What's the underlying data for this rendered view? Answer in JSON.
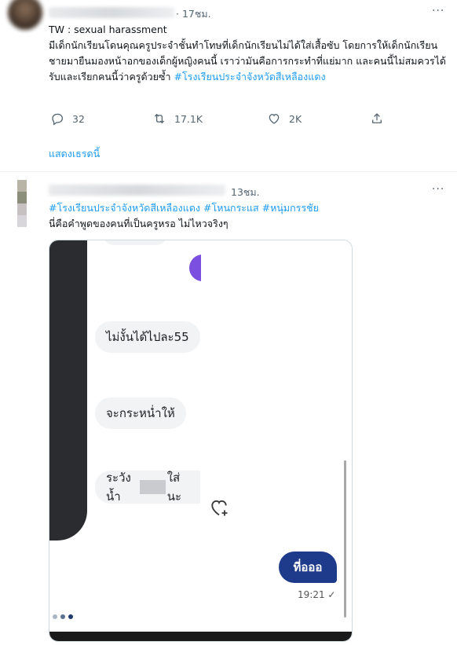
{
  "tweet1": {
    "time": "· 17ชม.",
    "text_line1": "TW : sexual harassment",
    "text_body": "มีเด็กนักเรียนโดนคุณครูประจำชั้นทำโทษที่เด็กนักเรียนไม่ได้ใส่เสื้อซับ โดยการให้เด็กนักเรียนชายมายืนมองหน้าอกของเด็กผู้หญิงคนนี้ เราว่ามันคือการกระทำที่แย่มาก และคนนี้ไม่สมควรได้รับและเรียกคนนี้ว่าครูด้วยซ้ำ",
    "hashtag": "#โรงเรียนประจำจังหวัดสีเหลืองแดง",
    "actions": {
      "reply_count": "32",
      "retweet_count": "17.1K",
      "like_count": "2K"
    },
    "show_thread": "แสดงเธรดนี้"
  },
  "tweet2": {
    "time": "13ชม.",
    "hashtags": "#โรงเรียนประจำจังหวัดสีเหลืองแดง #โหนกระแส #หนุ่มกรรชัย",
    "text": "นี่คือคำพูดของคนที่เป็นครูหรอ ไม่ไหวจริงๆ",
    "chat": {
      "bubble1": "ไม่งั้นได้ไปละ55",
      "bubble2": "จะกระหน่ำให้",
      "bubble3_start": "ระวังน้ำ",
      "bubble3_end": "ใส่นะ",
      "sent_message": "ที่อออ",
      "sent_time": "19:21 ✓"
    }
  },
  "icons": {
    "more": "···",
    "reply": "reply-icon",
    "retweet": "retweet-icon",
    "like": "heart-icon",
    "share": "share-icon"
  },
  "colors": {
    "link": "#1d9bf0",
    "secondary_text": "#536471",
    "sent_bubble": "#1e3a8a",
    "messenger_purple": "#7b4fe0"
  }
}
